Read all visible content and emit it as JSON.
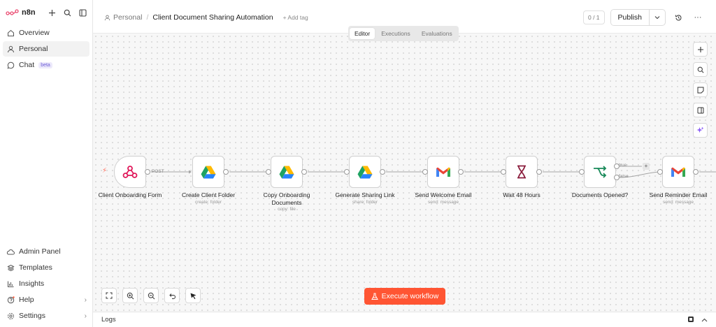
{
  "app": {
    "name": "n8n"
  },
  "sidebar": {
    "top": [
      {
        "label": "Overview",
        "icon": "home-icon"
      },
      {
        "label": "Personal",
        "icon": "user-icon",
        "active": true
      },
      {
        "label": "Chat",
        "icon": "chat-icon",
        "badge": "beta"
      }
    ],
    "bottom": [
      {
        "label": "Admin Panel",
        "icon": "cloud-icon"
      },
      {
        "label": "Templates",
        "icon": "templates-icon"
      },
      {
        "label": "Insights",
        "icon": "insights-icon"
      },
      {
        "label": "Help",
        "icon": "help-icon"
      },
      {
        "label": "Settings",
        "icon": "settings-icon"
      }
    ]
  },
  "header": {
    "breadcrumb_project": "Personal",
    "breadcrumb_sep": "/",
    "workflow_title": "Client Document Sharing Automation",
    "add_tag": "+ Add tag",
    "counter": "0 / 1",
    "publish_label": "Publish",
    "more_label": "···"
  },
  "tabs": [
    {
      "label": "Editor",
      "active": true
    },
    {
      "label": "Executions"
    },
    {
      "label": "Evaluations"
    }
  ],
  "workflow": {
    "nodes": [
      {
        "label": "Client Onboarding Form",
        "sub": "",
        "icon": "webhook-icon"
      },
      {
        "label": "Create Client Folder",
        "sub": "create: folder",
        "icon": "google-drive-icon"
      },
      {
        "label": "Copy Onboarding Documents",
        "sub": "copy: file",
        "icon": "google-drive-icon"
      },
      {
        "label": "Generate Sharing Link",
        "sub": "share: folder",
        "icon": "google-drive-icon"
      },
      {
        "label": "Send Welcome Email",
        "sub": "send: message",
        "icon": "gmail-icon"
      },
      {
        "label": "Wait 48 Hours",
        "sub": "",
        "icon": "hourglass-icon"
      },
      {
        "label": "Documents Opened?",
        "sub": "",
        "icon": "if-branch-icon"
      },
      {
        "label": "Send Reminder Email",
        "sub": "send: message",
        "icon": "gmail-icon"
      }
    ],
    "edge_post": "POST",
    "branch_true": "true",
    "branch_false": "false"
  },
  "execute_label": "Execute workflow",
  "logs": {
    "label": "Logs"
  },
  "colors": {
    "accent": "#ff5533",
    "drive_green": "#1ea362",
    "drive_yellow": "#ffba00",
    "drive_blue": "#2684fc",
    "gmail_red": "#ea4335",
    "webhook_pink": "#e0185a"
  }
}
